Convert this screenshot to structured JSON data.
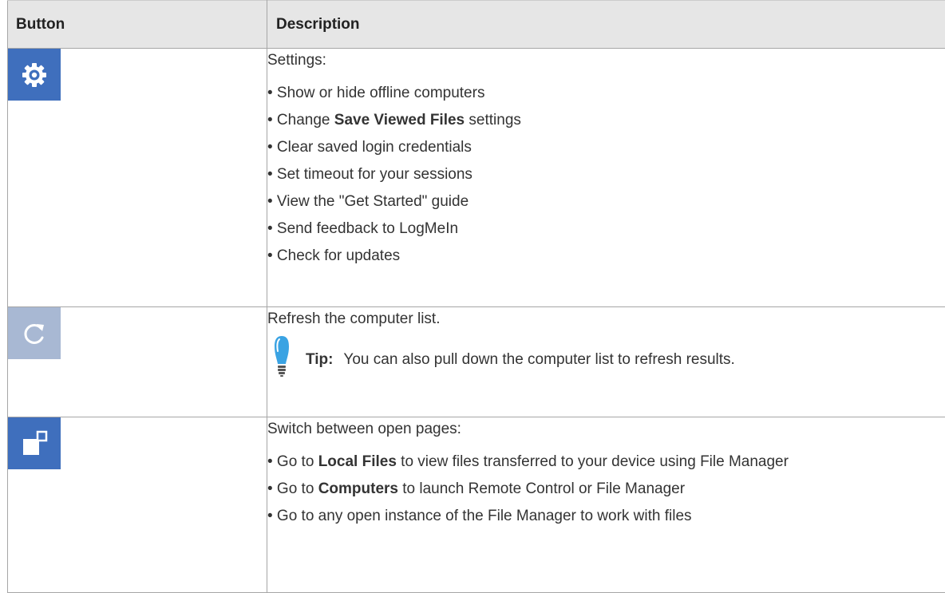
{
  "header": {
    "button_col": "Button",
    "description_col": "Description"
  },
  "colors": {
    "button_blue": "#3f6fbd",
    "button_disabled": "#a8b8d3",
    "header_bg": "#e6e6e6",
    "tip_bulb": "#3aa3e3"
  },
  "rows": [
    {
      "icon": "settings-gear-icon",
      "intro": "Settings:",
      "items": [
        {
          "prefix": "• Show or hide offline computers",
          "bold": "",
          "suffix": ""
        },
        {
          "prefix": "• Change ",
          "bold": "Save Viewed Files",
          "suffix": " settings"
        },
        {
          "prefix": "• Clear saved login credentials",
          "bold": "",
          "suffix": ""
        },
        {
          "prefix": "• Set timeout for your sessions",
          "bold": "",
          "suffix": ""
        },
        {
          "prefix": "• View the \"Get Started\" guide",
          "bold": "",
          "suffix": ""
        },
        {
          "prefix": "• Send feedback to LogMeIn",
          "bold": "",
          "suffix": ""
        },
        {
          "prefix": "• Check for updates",
          "bold": "",
          "suffix": ""
        }
      ]
    },
    {
      "icon": "refresh-icon",
      "intro": "Refresh the computer list.",
      "tip": {
        "icon": "lightbulb-icon",
        "label": "Tip:",
        "text": "You can also pull down the computer list to refresh results."
      }
    },
    {
      "icon": "switch-pages-icon",
      "intro": "Switch between open pages:",
      "items": [
        {
          "prefix": "• Go to ",
          "bold": "Local Files",
          "suffix": " to view files transferred to your device using File Manager"
        },
        {
          "prefix": "• Go to ",
          "bold": "Computers",
          "suffix": " to launch Remote Control or File Manager"
        },
        {
          "prefix": "• Go to any open instance of the File Manager to work with files",
          "bold": "",
          "suffix": ""
        }
      ]
    }
  ]
}
